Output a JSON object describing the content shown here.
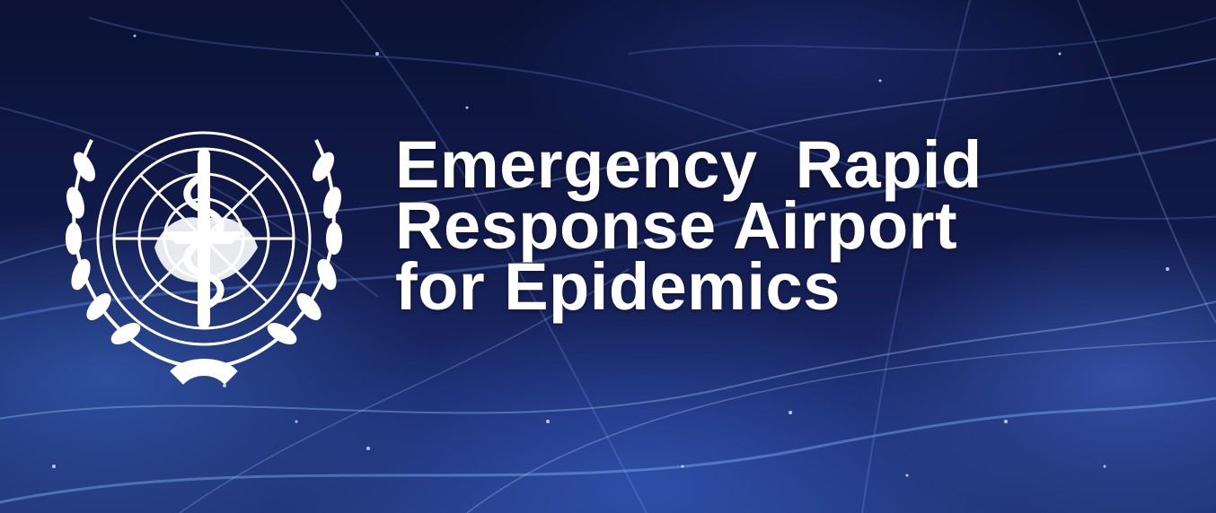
{
  "banner": {
    "emblem_icon": "who-emblem-icon",
    "title_lines": [
      "Emergency  Rapid",
      "Response Airport",
      "for Epidemics"
    ],
    "text_color": "#ffffff",
    "background_color": "#121a4a"
  }
}
